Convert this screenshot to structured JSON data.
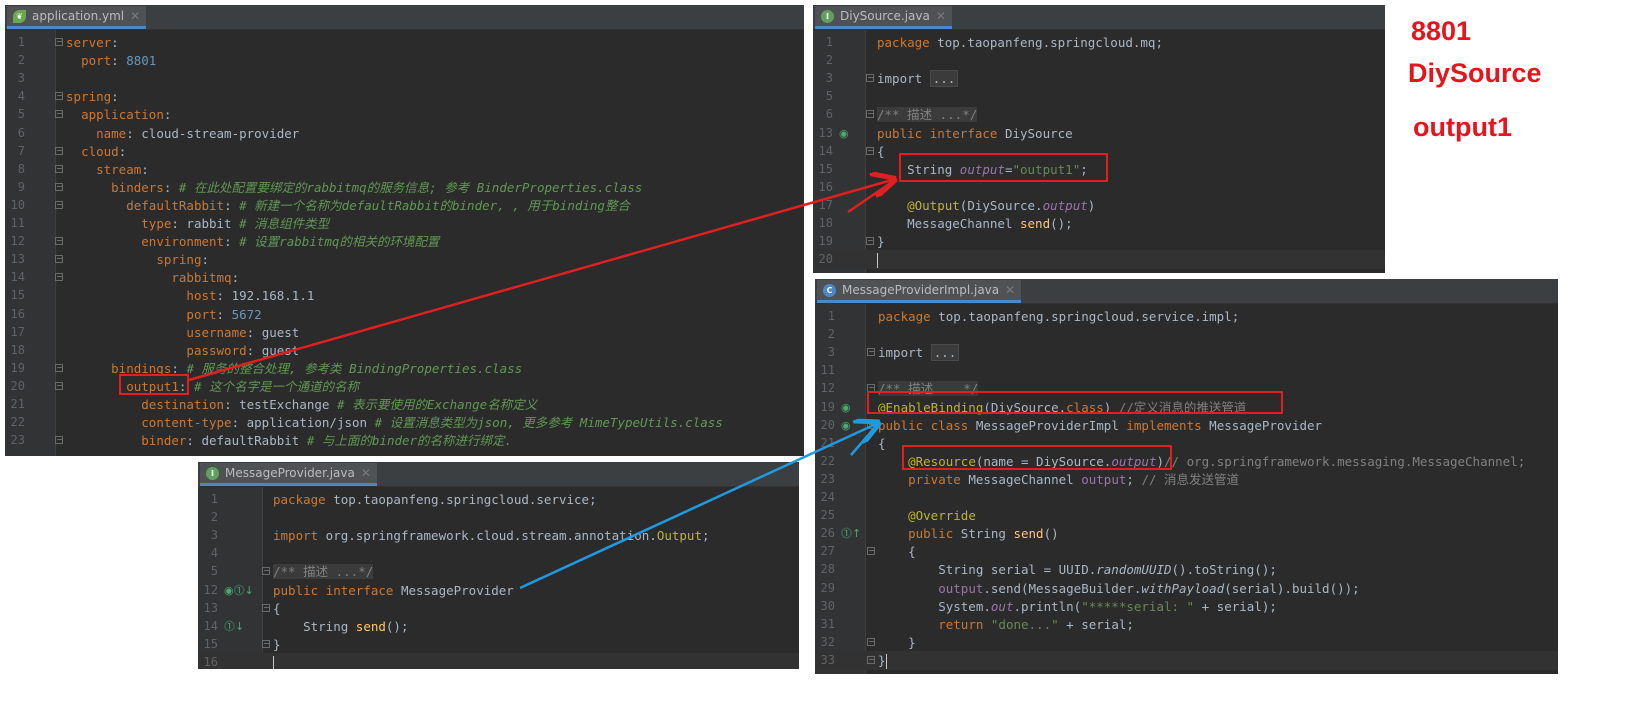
{
  "annotations": {
    "line1": "8801",
    "line2": "DiySource",
    "line3": "output1"
  },
  "colors": {
    "annotation": "#e8141c",
    "arrow_red": "#e02020",
    "arrow_blue": "#1e9be0",
    "editor_bg": "#2b2b2b"
  },
  "editors": {
    "yml": {
      "tab": "application.yml",
      "icon": "spring-leaf-icon",
      "lines": [
        {
          "n": "1",
          "t": "server:"
        },
        {
          "n": "2",
          "t": "  port: 8801"
        },
        {
          "n": "3",
          "t": ""
        },
        {
          "n": "4",
          "t": "spring:"
        },
        {
          "n": "5",
          "t": "  application:"
        },
        {
          "n": "6",
          "t": "    name: cloud-stream-provider"
        },
        {
          "n": "7",
          "t": "  cloud:"
        },
        {
          "n": "8",
          "t": "    stream:"
        },
        {
          "n": "9",
          "t": "      binders: # 在此处配置要绑定的rabbitmq的服务信息; 参考 BinderProperties.class"
        },
        {
          "n": "10",
          "t": "        defaultRabbit: # 新建一个名称为defaultRabbit的binder, , 用于binding整合"
        },
        {
          "n": "11",
          "t": "          type: rabbit # 消息组件类型"
        },
        {
          "n": "12",
          "t": "          environment: # 设置rabbitmq的相关的环境配置"
        },
        {
          "n": "13",
          "t": "            spring:"
        },
        {
          "n": "14",
          "t": "              rabbitmq:"
        },
        {
          "n": "15",
          "t": "                host: 192.168.1.1"
        },
        {
          "n": "16",
          "t": "                port: 5672"
        },
        {
          "n": "17",
          "t": "                username: guest"
        },
        {
          "n": "18",
          "t": "                password: guest"
        },
        {
          "n": "19",
          "t": "      bindings: # 服务的整合处理, 参考类 BindingProperties.class"
        },
        {
          "n": "20",
          "t": "        output1: # 这个名字是一个通道的名称"
        },
        {
          "n": "21",
          "t": "          destination: testExchange # 表示要使用的Exchange名称定义"
        },
        {
          "n": "22",
          "t": "          content-type: application/json # 设置消息类型为json, 更多参考 MimeTypeUtils.class"
        },
        {
          "n": "23",
          "t": "          binder: defaultRabbit # 与上面的binder的名称进行绑定."
        }
      ]
    },
    "diy": {
      "tab": "DiySource.java",
      "icon": "interface-icon",
      "lines": [
        {
          "n": "1",
          "t": "package top.taopanfeng.springcloud.mq;"
        },
        {
          "n": "2",
          "t": ""
        },
        {
          "n": "3",
          "t": "import ..."
        },
        {
          "n": "5",
          "t": ""
        },
        {
          "n": "6",
          "t": "/** 描述 ...*/"
        },
        {
          "n": "13",
          "t": "public interface DiySource"
        },
        {
          "n": "14",
          "t": "{"
        },
        {
          "n": "15",
          "t": "    String output=\"output1\";"
        },
        {
          "n": "16",
          "t": ""
        },
        {
          "n": "17",
          "t": "    @Output(DiySource.output)"
        },
        {
          "n": "18",
          "t": "    MessageChannel send();"
        },
        {
          "n": "19",
          "t": "}"
        },
        {
          "n": "20",
          "t": ""
        }
      ]
    },
    "impl": {
      "tab": "MessageProviderImpl.java",
      "icon": "class-icon",
      "lines": [
        {
          "n": "1",
          "t": "package top.taopanfeng.springcloud.service.impl;"
        },
        {
          "n": "2",
          "t": ""
        },
        {
          "n": "3",
          "t": "import ..."
        },
        {
          "n": "11",
          "t": ""
        },
        {
          "n": "12",
          "t": "/** 描述 ...*/"
        },
        {
          "n": "19",
          "t": "@EnableBinding(DiySource.class) //定义消息的推送管道"
        },
        {
          "n": "20",
          "t": "public class MessageProviderImpl implements MessageProvider"
        },
        {
          "n": "21",
          "t": "{"
        },
        {
          "n": "22",
          "t": "    @Resource(name = DiySource.output)// org.springframework.messaging.MessageChannel;"
        },
        {
          "n": "23",
          "t": "    private MessageChannel output; // 消息发送管道"
        },
        {
          "n": "24",
          "t": ""
        },
        {
          "n": "25",
          "t": "    @Override"
        },
        {
          "n": "26",
          "t": "    public String send()"
        },
        {
          "n": "27",
          "t": "    {"
        },
        {
          "n": "28",
          "t": "        String serial = UUID.randomUUID().toString();"
        },
        {
          "n": "29",
          "t": "        output.send(MessageBuilder.withPayload(serial).build());"
        },
        {
          "n": "30",
          "t": "        System.out.println(\"*****serial: \" + serial);"
        },
        {
          "n": "31",
          "t": "        return \"done...\" + serial;"
        },
        {
          "n": "32",
          "t": "    }"
        },
        {
          "n": "33",
          "t": "}"
        }
      ]
    },
    "mp": {
      "tab": "MessageProvider.java",
      "icon": "interface-icon",
      "lines": [
        {
          "n": "1",
          "t": "package top.taopanfeng.springcloud.service;"
        },
        {
          "n": "2",
          "t": ""
        },
        {
          "n": "3",
          "t": "import org.springframework.cloud.stream.annotation.Output;"
        },
        {
          "n": "4",
          "t": ""
        },
        {
          "n": "5",
          "t": "/** 描述 ...*/"
        },
        {
          "n": "12",
          "t": "public interface MessageProvider"
        },
        {
          "n": "13",
          "t": "{"
        },
        {
          "n": "14",
          "t": "    String send();"
        },
        {
          "n": "15",
          "t": "}"
        },
        {
          "n": "16",
          "t": ""
        }
      ]
    }
  }
}
